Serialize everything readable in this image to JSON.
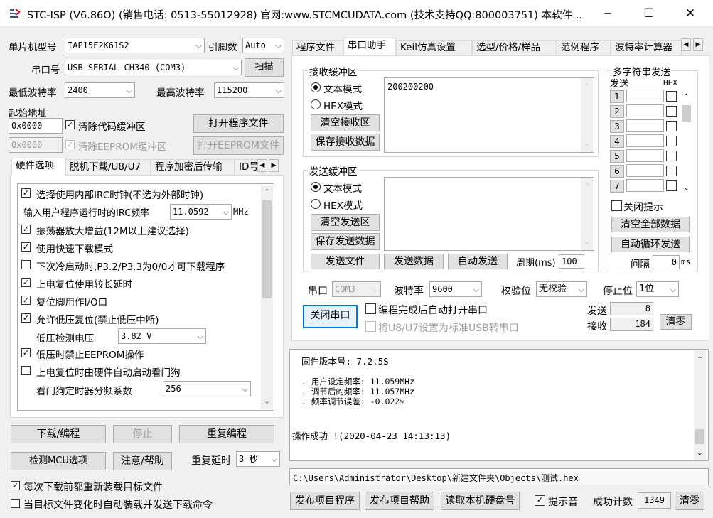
{
  "window": {
    "title": "STC-ISP (V6.86O) (销售电话: 0513-55012928) 官网:www.STCMCUDATA.com  (技术支持QQ:800003751) 本软件...",
    "min": "─",
    "max": "☐",
    "close": "✕"
  },
  "left": {
    "mcu_label": "单片机型号",
    "mcu_value": "IAP15F2K61S2",
    "pins_label": "引脚数",
    "pins_value": "Auto",
    "port_label": "串口号",
    "port_value": "USB-SERIAL CH340 (COM3)",
    "scan": "扫描",
    "min_baud_label": "最低波特率",
    "min_baud": "2400",
    "max_baud_label": "最高波特率",
    "max_baud": "115200",
    "start_addr_label": "起始地址",
    "addr1": "0x0000",
    "clear_code": "清除代码缓冲区",
    "open_prog": "打开程序文件",
    "addr2": "0x0000",
    "clear_eeprom": "清除EEPROM缓冲区",
    "open_eeprom": "打开EEPROM文件",
    "tabs": [
      "硬件选项",
      "脱机下载/U8/U7",
      "程序加密后传输",
      "ID号"
    ],
    "options": [
      {
        "checked": true,
        "text": "选择使用内部IRC时钟(不选为外部时钟)"
      },
      {
        "checked": true,
        "text": "振荡器放大增益(12M以上建议选择)"
      },
      {
        "checked": true,
        "text": "使用快速下载模式"
      },
      {
        "checked": false,
        "text": "下次冷启动时,P3.2/P3.3为0/0才可下载程序"
      },
      {
        "checked": true,
        "text": "上电复位使用较长延时"
      },
      {
        "checked": true,
        "text": "复位脚用作I/O口"
      },
      {
        "checked": true,
        "text": "允许低压复位(禁止低压中断)"
      },
      {
        "checked": true,
        "text": "低压时禁止EEPROM操作"
      },
      {
        "checked": false,
        "text": "上电复位时由硬件自动启动看门狗"
      }
    ],
    "irc_label": "输入用户程序运行时的IRC频率",
    "irc_value": "11.0592",
    "irc_unit": "MHz",
    "lv_label": "低压检测电压",
    "lv_value": "3.82 V",
    "wdt_label": "看门狗定时器分频系数",
    "wdt_value": "256",
    "btn_download": "下载/编程",
    "btn_stop": "停止",
    "btn_reprog": "重复编程",
    "btn_detect": "检测MCU选项",
    "btn_help": "注意/帮助",
    "delay_label": "重复延时",
    "delay_value": "3 秒",
    "reload_check": "每次下载前都重新装载目标文件",
    "auto_send_check": "当目标文件变化时自动装载并发送下载命令"
  },
  "right": {
    "tabs": [
      "程序文件",
      "串口助手",
      "Keil仿真设置",
      "选型/价格/样品",
      "范例程序",
      "波特率计算器"
    ],
    "recv_group": "接收缓冲区",
    "text_mode": "文本模式",
    "hex_mode": "HEX模式",
    "clear_recv": "清空接收区",
    "save_recv": "保存接收数据",
    "recv_content": "200200200",
    "send_group": "发送缓冲区",
    "clear_send": "清空发送区",
    "save_send": "保存发送数据",
    "send_file": "发送文件",
    "send_data": "发送数据",
    "auto_send": "自动发送",
    "period_label": "周期(ms)",
    "period_value": "100",
    "multi_title": "多字符串发送",
    "multi_send": "发送",
    "multi_hex": "HEX",
    "multi_rows": [
      "1",
      "2",
      "3",
      "4",
      "5",
      "6",
      "7"
    ],
    "close_tip": "关闭提示",
    "clear_all": "清空全部数据",
    "auto_loop": "自动循环发送",
    "interval_label": "间隔",
    "interval_value": "0",
    "interval_unit": "ms",
    "com_label": "串口",
    "com_value": "COM3",
    "baud_label": "波特率",
    "baud_value": "9600",
    "parity_label": "校验位",
    "parity_value": "无校验",
    "stop_label": "停止位",
    "stop_value": "1位",
    "close_port": "关闭串口",
    "auto_open": "编程完成后自动打开串口",
    "usb_set": "将U8/U7设置为标准USB转串口",
    "sent_label": "发送",
    "sent_count": "8",
    "recv_label": "接收",
    "recv_count": "184",
    "clear_count": "清零"
  },
  "log": {
    "fw": "固件版本号: 7.2.5S",
    "l1": ". 用户设定频率: 11.059MHz",
    "l2": ". 调节后的频率: 11.057MHz",
    "l3": ". 频率调节误差: -0.022%",
    "ok": "操作成功 !(2020-04-23 14:13:13)"
  },
  "footer": {
    "path": "C:\\Users\\Administrator\\Desktop\\新建文件夹\\Objects\\测试.hex",
    "publish_prog": "发布项目程序",
    "publish_help": "发布项目帮助",
    "read_disk": "读取本机硬盘号",
    "beep": "提示音",
    "success_label": "成功计数",
    "success_count": "1349",
    "clear": "清零"
  }
}
